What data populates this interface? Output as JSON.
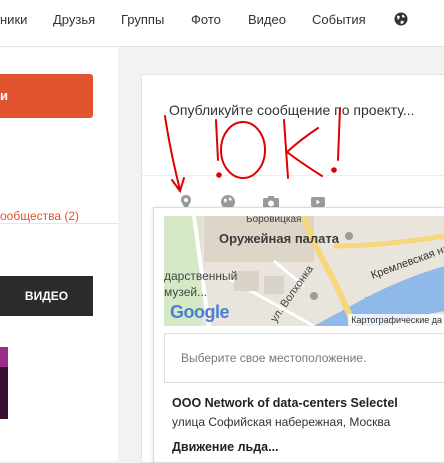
{
  "topnav": {
    "items": [
      "ники",
      "Друзья",
      "Группы",
      "Фото",
      "Видео",
      "События"
    ],
    "globe_icon": "globe-icon"
  },
  "sidebar": {
    "orange_button": "и",
    "communities_link": "ообщества (2)",
    "video_button": "ВИДЕО"
  },
  "composer": {
    "placeholder": "Опубликуйте сообщение по проекту...",
    "tools": [
      "location-pin-icon",
      "globe-icon",
      "camera-icon",
      "video-icon"
    ]
  },
  "handwriting": {
    "text": "!OK!"
  },
  "location_popup": {
    "map_labels": {
      "top": "Боровицкая",
      "armoury": "Оружейная палата",
      "museum": "дарственный\nмузей...",
      "embankment": "Кремлевская на",
      "street": "ул. Волхонка",
      "google": "Google",
      "credits": "Картографические да"
    },
    "placeholder": "Выберите свое местоположение.",
    "results": [
      {
        "title": "OOO Network of data-centers Selectel",
        "subtitle": "улица Софийская набережная, Москва"
      },
      {
        "title": "Движение льда...",
        "subtitle": ""
      }
    ]
  },
  "colors": {
    "accent_orange": "#e0532f",
    "dark_button": "#2b2b2b",
    "handwriting_red": "#e00000"
  }
}
